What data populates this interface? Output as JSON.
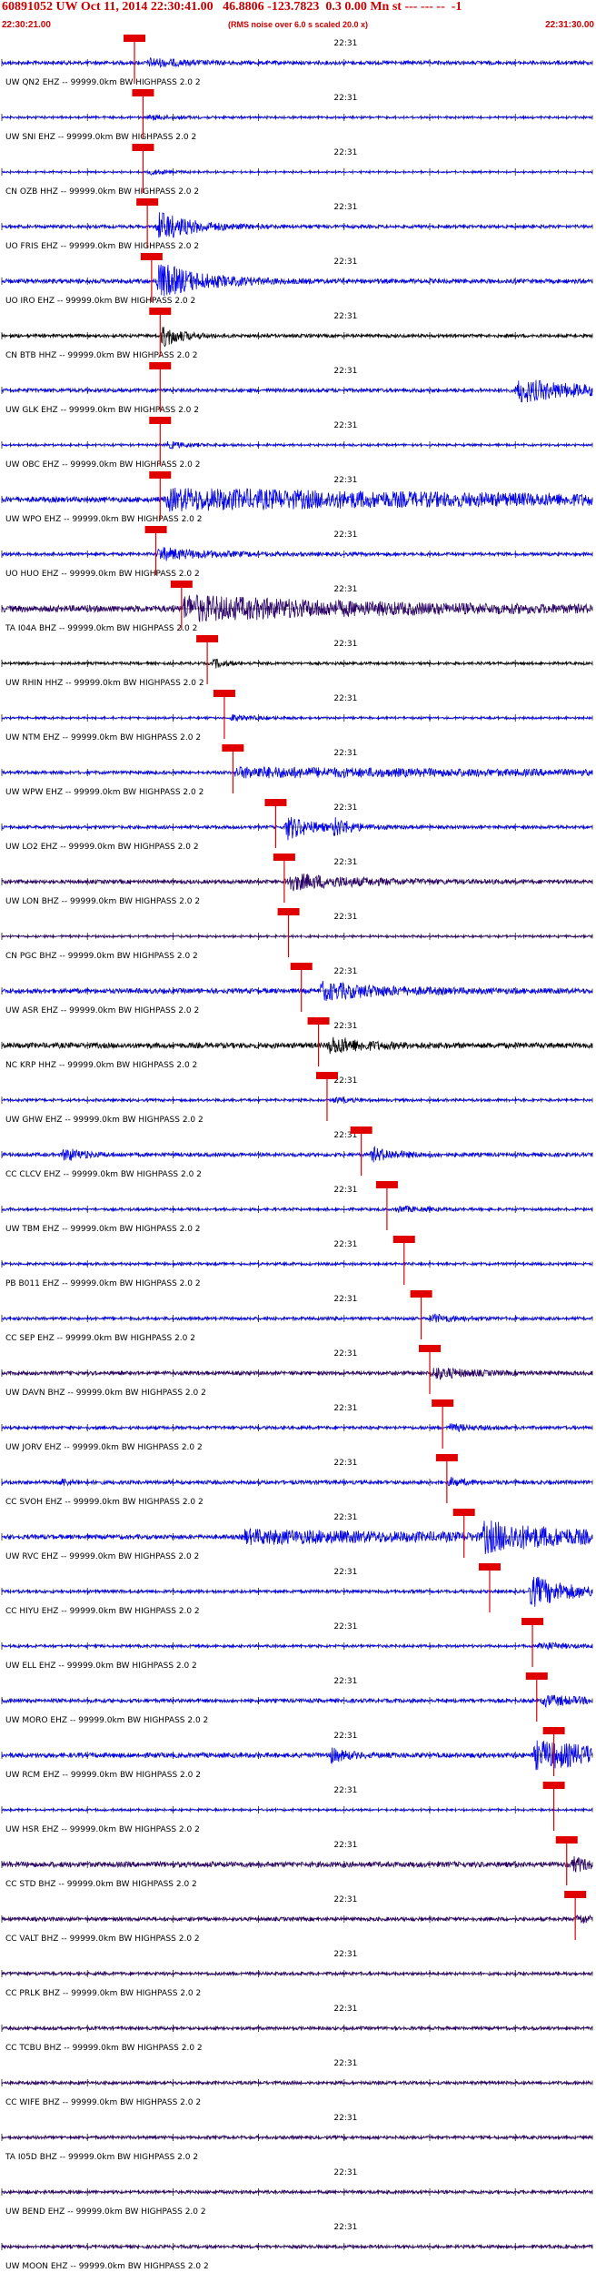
{
  "header": {
    "title": "60891052 UW Oct 11, 2014 22:30:41.00   46.8806 -123.7823  0.3 0.00 Mn st --- --- --  -1",
    "subtitle": "(RMS noise over 6.0 s scaled 20.0 x)",
    "start_time": "22:30:21.00",
    "end_time": "22:31:30.00"
  },
  "colors": {
    "header_text": "#cc0000",
    "pick_line": "#e00000",
    "trace_blue": "#0000ee",
    "trace_black": "#000000",
    "trace_purple": "#2a0066",
    "tick": "#000000"
  },
  "chart_data": {
    "type": "line",
    "x_range_seconds": [
      0,
      69
    ],
    "time_label": "22:31",
    "time_label_offset_seconds": 39,
    "channels": [
      {
        "label": "UW QN2 EHZ -- 99999.0km BW  HIGHPASS  2.0  2",
        "pick_s": 15.5,
        "amp": 0.35,
        "color": "#0000ee",
        "events": [
          [
            17,
            4,
            0.8
          ]
        ]
      },
      {
        "label": "UW SNI EHZ -- 99999.0km BW  HIGHPASS  2.0  2",
        "pick_s": 16.5,
        "amp": 0.2,
        "color": "#0000ee",
        "events": [
          [
            17,
            3,
            0.5
          ]
        ]
      },
      {
        "label": "CN OZB HHZ -- 99999.0km BW  HIGHPASS  2.0  2",
        "pick_s": 16.5,
        "amp": 0.15,
        "color": "#0000ee",
        "events": [
          [
            17,
            3,
            0.5
          ]
        ]
      },
      {
        "label": "UO FRIS EHZ -- 99999.0km BW  HIGHPASS  2.0  2",
        "pick_s": 17.0,
        "amp": 0.3,
        "color": "#0000ee",
        "events": [
          [
            18,
            4,
            3.0
          ]
        ]
      },
      {
        "label": "UO IRO EHZ -- 99999.0km BW  HIGHPASS  2.0  2",
        "pick_s": 17.5,
        "amp": 0.4,
        "color": "#0000ee",
        "events": [
          [
            18,
            5,
            3.5
          ]
        ]
      },
      {
        "label": "CN BTB HHZ -- 99999.0km BW  HIGHPASS  2.0  2",
        "pick_s": 18.5,
        "amp": 0.3,
        "color": "#000000",
        "events": [
          [
            18.5,
            2,
            2.5
          ]
        ]
      },
      {
        "label": "UW GLK EHZ -- 99999.0km BW  HIGHPASS  2.0  2",
        "pick_s": 18.5,
        "amp": 0.35,
        "color": "#0000ee",
        "events": [
          [
            60,
            8,
            2.2
          ]
        ]
      },
      {
        "label": "UW OBC EHZ -- 99999.0km BW  HIGHPASS  2.0  2",
        "pick_s": 18.5,
        "amp": 0.2,
        "color": "#0000ee",
        "events": [
          [
            19,
            3,
            0.6
          ]
        ]
      },
      {
        "label": "UW WPO EHZ -- 99999.0km BW  HIGHPASS  2.0  2",
        "pick_s": 18.5,
        "amp": 0.5,
        "color": "#0000ee",
        "events": [
          [
            19,
            50,
            1.8
          ]
        ]
      },
      {
        "label": "UO HUO EHZ -- 99999.0km BW  HIGHPASS  2.0  2",
        "pick_s": 18.0,
        "amp": 0.3,
        "color": "#0000ee",
        "events": [
          [
            18,
            6,
            1.2
          ]
        ]
      },
      {
        "label": "TA I04A BHZ -- 99999.0km BW  HIGHPASS  2.0  2",
        "pick_s": 21.0,
        "amp": 0.6,
        "color": "#2a0066",
        "events": [
          [
            21,
            22,
            2.2
          ]
        ]
      },
      {
        "label": "UW RHIN HHZ -- 99999.0km BW  HIGHPASS  2.0  2",
        "pick_s": 24.0,
        "amp": 0.25,
        "color": "#000000",
        "events": [
          [
            24.5,
            1.5,
            1.0
          ]
        ]
      },
      {
        "label": "UW NTM EHZ -- 99999.0km BW  HIGHPASS  2.0  2",
        "pick_s": 26.0,
        "amp": 0.2,
        "color": "#0000ee",
        "events": [
          [
            26.5,
            3,
            0.6
          ]
        ]
      },
      {
        "label": "UW WPW EHZ -- 99999.0km BW  HIGHPASS  2.0  2",
        "pick_s": 27.0,
        "amp": 0.3,
        "color": "#0000ee",
        "events": [
          [
            27,
            40,
            0.9
          ]
        ]
      },
      {
        "label": "UW LO2 EHZ -- 99999.0km BW  HIGHPASS  2.0  2",
        "pick_s": 32.0,
        "amp": 0.3,
        "color": "#0000ee",
        "events": [
          [
            33,
            3,
            2.5
          ],
          [
            38.5,
            2,
            1.8
          ]
        ]
      },
      {
        "label": "UW LON BHZ -- 99999.0km BW  HIGHPASS  2.0  2",
        "pick_s": 33.0,
        "amp": 0.35,
        "color": "#2a0066",
        "events": [
          [
            33,
            8,
            1.6
          ]
        ]
      },
      {
        "label": "CN PGC BHZ -- 99999.0km BW  HIGHPASS  2.0  2",
        "pick_s": 33.5,
        "amp": 0.2,
        "color": "#2a0066",
        "events": []
      },
      {
        "label": "UW ASR EHZ -- 99999.0km BW  HIGHPASS  2.0  2",
        "pick_s": 35.0,
        "amp": 0.45,
        "color": "#0000ee",
        "events": [
          [
            37,
            8,
            1.6
          ]
        ]
      },
      {
        "label": "NC KRP HHZ -- 99999.0km BW  HIGHPASS  2.0  2",
        "pick_s": 37.0,
        "amp": 0.5,
        "color": "#000000",
        "events": [
          [
            38,
            4,
            1.6
          ]
        ]
      },
      {
        "label": "UW GHW EHZ -- 99999.0km BW  HIGHPASS  2.0  2",
        "pick_s": 38.0,
        "amp": 0.25,
        "color": "#0000ee",
        "events": [
          [
            38.5,
            2,
            0.5
          ]
        ]
      },
      {
        "label": "CC CLCV EHZ -- 99999.0km BW  HIGHPASS  2.0  2",
        "pick_s": 42.0,
        "amp": 0.35,
        "color": "#0000ee",
        "events": [
          [
            7,
            2,
            1.5
          ],
          [
            43,
            3,
            1.3
          ]
        ]
      },
      {
        "label": "UW TBM EHZ -- 99999.0km BW  HIGHPASS  2.0  2",
        "pick_s": 45.0,
        "amp": 0.25,
        "color": "#0000ee",
        "events": [
          [
            46,
            3,
            0.6
          ]
        ]
      },
      {
        "label": "PB B011 EHZ -- 99999.0km BW  HIGHPASS  2.0  2",
        "pick_s": 47.0,
        "amp": 0.25,
        "color": "#0000ee",
        "events": []
      },
      {
        "label": "CC SEP EHZ -- 99999.0km BW  HIGHPASS  2.0  2",
        "pick_s": 49.0,
        "amp": 0.3,
        "color": "#0000ee",
        "events": [
          [
            50,
            3,
            0.8
          ]
        ]
      },
      {
        "label": "UW DAVN BHZ -- 99999.0km BW  HIGHPASS  2.0  2",
        "pick_s": 50.0,
        "amp": 0.35,
        "color": "#2a0066",
        "events": [
          [
            50,
            4,
            1.2
          ]
        ]
      },
      {
        "label": "UW JORV EHZ -- 99999.0km BW  HIGHPASS  2.0  2",
        "pick_s": 51.5,
        "amp": 0.3,
        "color": "#0000ee",
        "events": [
          [
            52,
            3,
            0.7
          ]
        ]
      },
      {
        "label": "CC SVOH EHZ -- 99999.0km BW  HIGHPASS  2.0  2",
        "pick_s": 52.0,
        "amp": 0.35,
        "color": "#0000ee",
        "events": [
          [
            6.5,
            1.5,
            0.8
          ],
          [
            52,
            2,
            0.8
          ]
        ]
      },
      {
        "label": "UW RVC EHZ -- 99999.0km BW  HIGHPASS  2.0  2",
        "pick_s": 54.0,
        "amp": 0.4,
        "color": "#0000ee",
        "events": [
          [
            28,
            30,
            1.2
          ],
          [
            56,
            10,
            2.5
          ]
        ]
      },
      {
        "label": "CC HIYU EHZ -- 99999.0km BW  HIGHPASS  2.0  2",
        "pick_s": 57.0,
        "amp": 0.3,
        "color": "#0000ee",
        "events": [
          [
            61.5,
            5,
            3.0
          ]
        ]
      },
      {
        "label": "UW ELL EHZ -- 99999.0km BW  HIGHPASS  2.0  2",
        "pick_s": 62.0,
        "amp": 0.25,
        "color": "#0000ee",
        "events": [
          [
            62.5,
            3,
            0.8
          ]
        ]
      },
      {
        "label": "UW MORO EHZ -- 99999.0km BW  HIGHPASS  2.0  2",
        "pick_s": 62.5,
        "amp": 0.35,
        "color": "#0000ee",
        "events": [
          [
            63,
            5,
            1.0
          ]
        ]
      },
      {
        "label": "UW RCM EHZ -- 99999.0km BW  HIGHPASS  2.0  2",
        "pick_s": 64.5,
        "amp": 0.45,
        "color": "#0000ee",
        "events": [
          [
            38,
            2,
            1.5
          ],
          [
            62,
            12,
            2.5
          ]
        ]
      },
      {
        "label": "UW HSR EHZ -- 99999.0km BW  HIGHPASS  2.0  2",
        "pick_s": 64.5,
        "amp": 0.2,
        "color": "#0000ee",
        "events": []
      },
      {
        "label": "CC STD BHZ -- 99999.0km BW  HIGHPASS  2.0  2",
        "pick_s": 66.0,
        "amp": 0.5,
        "color": "#2a0066",
        "events": [
          [
            66.5,
            2,
            1.5
          ]
        ]
      },
      {
        "label": "CC VALT BHZ -- 99999.0km BW  HIGHPASS  2.0  2",
        "pick_s": 67.0,
        "amp": 0.35,
        "color": "#2a0066",
        "events": [
          [
            67,
            2,
            1.0
          ]
        ]
      },
      {
        "label": "CC PRLK BHZ -- 99999.0km BW  HIGHPASS  2.0  2",
        "pick_s": null,
        "amp": 0.3,
        "color": "#2a0066",
        "events": []
      },
      {
        "label": "CC TCBU BHZ -- 99999.0km BW  HIGHPASS  2.0  2",
        "pick_s": null,
        "amp": 0.3,
        "color": "#2a0066",
        "events": []
      },
      {
        "label": "CC WIFE BHZ -- 99999.0km BW  HIGHPASS  2.0  2",
        "pick_s": null,
        "amp": 0.3,
        "color": "#2a0066",
        "events": []
      },
      {
        "label": "TA I05D BHZ -- 99999.0km BW  HIGHPASS  2.0  2",
        "pick_s": null,
        "amp": 0.3,
        "color": "#2a0066",
        "events": []
      },
      {
        "label": "UW BEND EHZ -- 99999.0km BW  HIGHPASS  2.0  2",
        "pick_s": null,
        "amp": 0.3,
        "color": "#2a0066",
        "events": []
      },
      {
        "label": "UW MOON EHZ -- 99999.0km BW  HIGHPASS  2.0  2",
        "pick_s": null,
        "amp": 0.3,
        "color": "#2a0066",
        "events": []
      }
    ]
  }
}
